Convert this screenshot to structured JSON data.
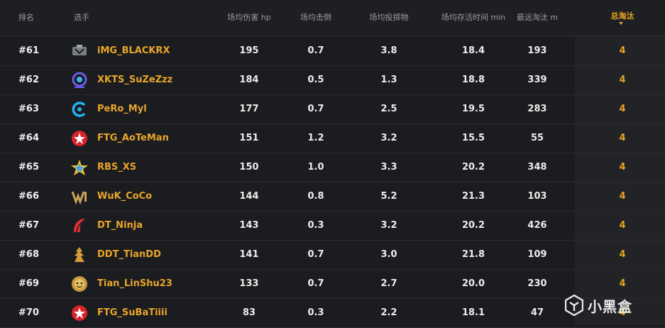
{
  "colors": {
    "accent": "#e6a423",
    "background": "#1b1c1f"
  },
  "header": {
    "rank": "排名",
    "player": "选手",
    "damage": "场均伤害 hp",
    "kills": "场均击倒",
    "throwables": "场均投掷物",
    "survival": "场均存活时间 min",
    "longest_kill": "最远淘汰 m",
    "total_kills": "总淘汰"
  },
  "rows": [
    {
      "rank": "#61",
      "player": "iMG_BLACKRX",
      "damage": "195",
      "kills": "0.7",
      "throwables": "3.8",
      "survival": "18.4",
      "longest": "193",
      "total": "4",
      "logo": "img-team-logo"
    },
    {
      "rank": "#62",
      "player": "XKTS_SuZeZzz",
      "damage": "184",
      "kills": "0.5",
      "throwables": "1.3",
      "survival": "18.8",
      "longest": "339",
      "total": "4",
      "logo": "xkts-team-logo"
    },
    {
      "rank": "#63",
      "player": "PeRo_Myl",
      "damage": "177",
      "kills": "0.7",
      "throwables": "2.5",
      "survival": "19.5",
      "longest": "283",
      "total": "4",
      "logo": "pero-team-logo"
    },
    {
      "rank": "#64",
      "player": "FTG_AoTeMan",
      "damage": "151",
      "kills": "1.2",
      "throwables": "3.2",
      "survival": "15.5",
      "longest": "55",
      "total": "4",
      "logo": "ftg-team-logo"
    },
    {
      "rank": "#65",
      "player": "RBS_XS",
      "damage": "150",
      "kills": "1.0",
      "throwables": "3.3",
      "survival": "20.2",
      "longest": "348",
      "total": "4",
      "logo": "rbs-team-logo"
    },
    {
      "rank": "#66",
      "player": "WuK_CoCo",
      "damage": "144",
      "kills": "0.8",
      "throwables": "5.2",
      "survival": "21.3",
      "longest": "103",
      "total": "4",
      "logo": "wuk-team-logo"
    },
    {
      "rank": "#67",
      "player": "DT_Ninja",
      "damage": "143",
      "kills": "0.3",
      "throwables": "3.2",
      "survival": "20.2",
      "longest": "426",
      "total": "4",
      "logo": "dt-team-logo"
    },
    {
      "rank": "#68",
      "player": "DDT_TianDD",
      "damage": "141",
      "kills": "0.7",
      "throwables": "3.0",
      "survival": "21.8",
      "longest": "109",
      "total": "4",
      "logo": "ddt-team-logo"
    },
    {
      "rank": "#69",
      "player": "Tian_LinShu23",
      "damage": "133",
      "kills": "0.7",
      "throwables": "2.7",
      "survival": "20.0",
      "longest": "230",
      "total": "4",
      "logo": "tian-team-logo"
    },
    {
      "rank": "#70",
      "player": "FTG_SuBaTiiii",
      "damage": "83",
      "kills": "0.3",
      "throwables": "2.2",
      "survival": "18.1",
      "longest": "47",
      "total": "4",
      "logo": "ftg-team-logo"
    }
  ],
  "watermark": {
    "text": "小黑盒"
  }
}
